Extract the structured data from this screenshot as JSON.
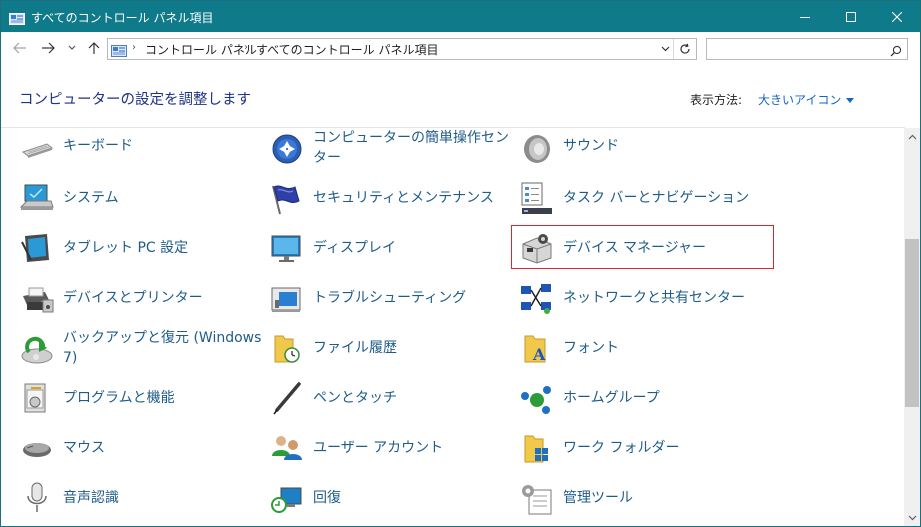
{
  "window": {
    "title": "すべてのコントロール パネル項目",
    "controls": {
      "minimize_icon": "minimize-icon",
      "maximize_icon": "maximize-icon",
      "close_icon": "close-icon"
    }
  },
  "nav": {
    "back_icon": "arrow-left-icon",
    "forward_icon": "arrow-right-icon",
    "recent_icon": "chevron-down-icon",
    "up_icon": "arrow-up-icon",
    "breadcrumb": [
      "コントロール パネル",
      "すべてのコントロール パネル項目"
    ],
    "search_placeholder": "",
    "search_icon": "search-icon",
    "refresh_icon": "refresh-icon"
  },
  "header": {
    "title": "コンピューターの設定を調整します",
    "view_by_label": "表示方法:",
    "view_by_value": "大きいアイコン"
  },
  "items": [
    {
      "label": "キーボード",
      "icon": "keyboard-icon"
    },
    {
      "label": "コンピューターの簡単操作センター",
      "icon": "ease-of-access-icon"
    },
    {
      "label": "サウンド",
      "icon": "speaker-icon"
    },
    {
      "label": "システム",
      "icon": "computer-icon"
    },
    {
      "label": "セキュリティとメンテナンス",
      "icon": "flag-icon"
    },
    {
      "label": "タスク バーとナビゲーション",
      "icon": "taskbar-icon"
    },
    {
      "label": "タブレット PC 設定",
      "icon": "tablet-icon"
    },
    {
      "label": "ディスプレイ",
      "icon": "monitor-icon"
    },
    {
      "label": "デバイス マネージャー",
      "icon": "device-manager-icon"
    },
    {
      "label": "デバイスとプリンター",
      "icon": "printer-icon"
    },
    {
      "label": "トラブルシューティング",
      "icon": "troubleshoot-icon"
    },
    {
      "label": "ネットワークと共有センター",
      "icon": "network-icon"
    },
    {
      "label": "バックアップと復元 (Windows 7)",
      "icon": "backup-icon"
    },
    {
      "label": "ファイル履歴",
      "icon": "file-history-icon"
    },
    {
      "label": "フォント",
      "icon": "font-folder-icon"
    },
    {
      "label": "プログラムと機能",
      "icon": "programs-icon"
    },
    {
      "label": "ペンとタッチ",
      "icon": "pen-icon"
    },
    {
      "label": "ホームグループ",
      "icon": "homegroup-icon"
    },
    {
      "label": "マウス",
      "icon": "mouse-icon"
    },
    {
      "label": "ユーザー アカウント",
      "icon": "users-icon"
    },
    {
      "label": "ワーク フォルダー",
      "icon": "work-folders-icon"
    },
    {
      "label": "音声認識",
      "icon": "microphone-icon"
    },
    {
      "label": "回復",
      "icon": "recovery-icon"
    },
    {
      "label": "管理ツール",
      "icon": "admin-tools-icon"
    }
  ],
  "colors": {
    "titlebar": "#0f7a8a",
    "link": "#1e5c8a",
    "heading": "#1e3287",
    "highlight_border": "#e0242b"
  }
}
